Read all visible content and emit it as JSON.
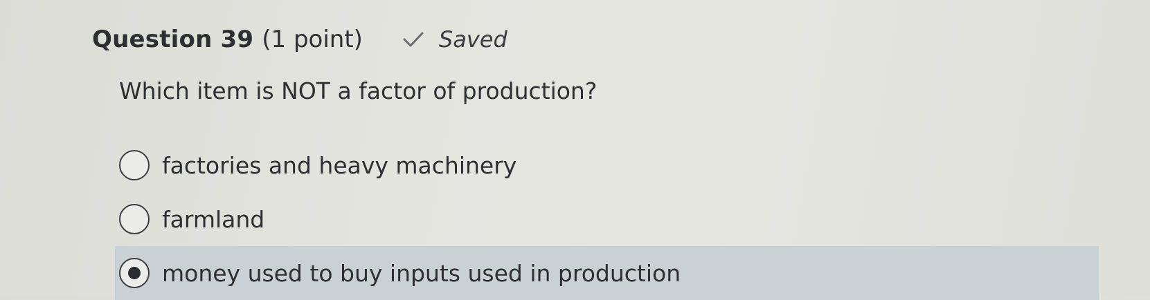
{
  "question": {
    "title": "Question 39",
    "points": "(1 point)",
    "status_icon": "check-icon",
    "status_label": "Saved",
    "prompt": "Which item is NOT a factor of production?"
  },
  "options": [
    {
      "label": "factories and heavy machinery",
      "selected": false
    },
    {
      "label": "farmland",
      "selected": false
    },
    {
      "label": "money used to buy inputs used in production",
      "selected": true
    }
  ],
  "colors": {
    "selected_bg": "#c9d1d4",
    "text": "#2e2f31"
  }
}
